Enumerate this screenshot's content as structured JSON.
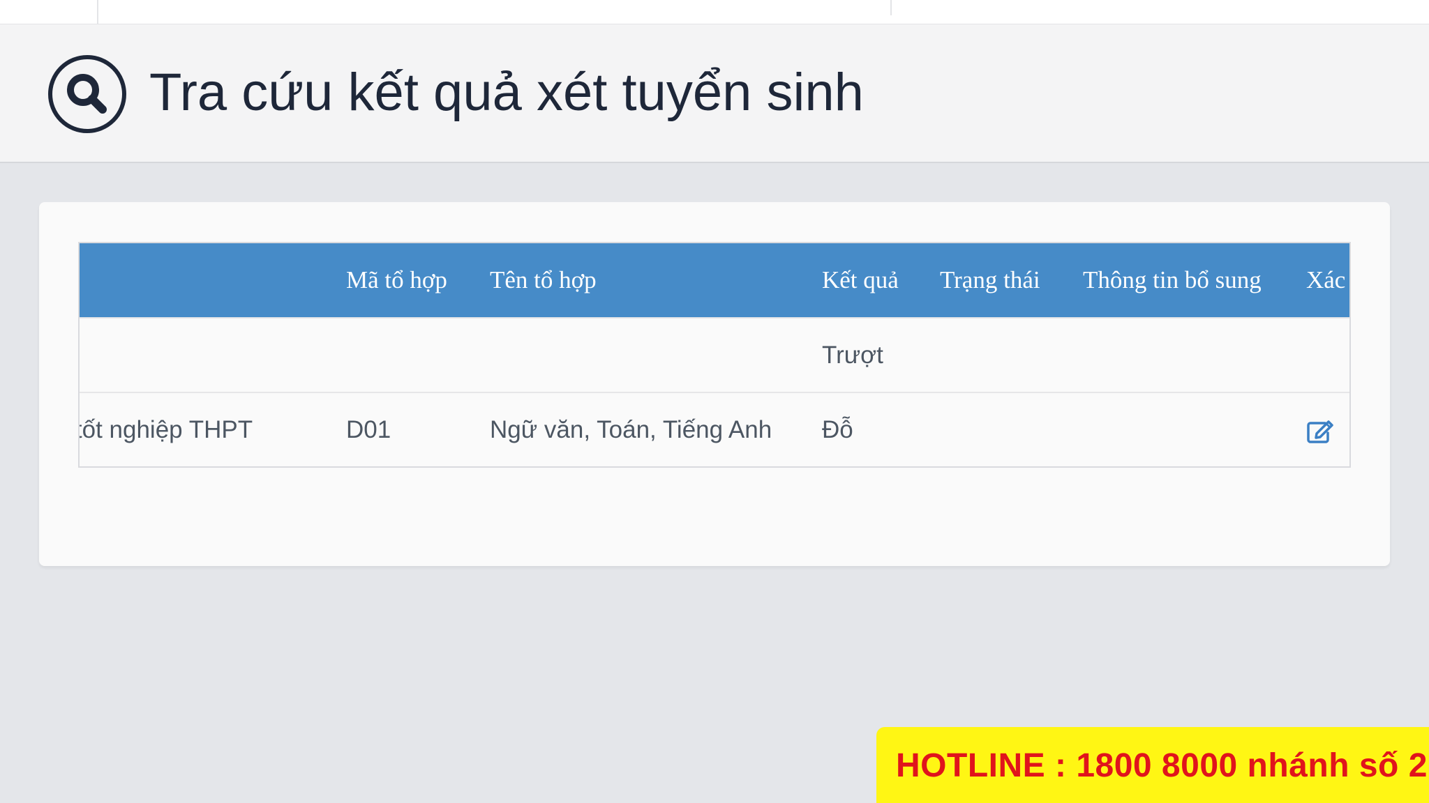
{
  "header": {
    "title": "Tra cứu kết quả xét tuyển sinh",
    "icon": "search-icon"
  },
  "table": {
    "columns": [
      "",
      "",
      "Mã tổ hợp",
      "Tên tổ hợp",
      "Kết quả",
      "Trạng thái",
      "Thông tin bổ sung",
      "Xác"
    ],
    "rows": [
      {
        "c0": "",
        "c1": "",
        "c2": "",
        "c3": "",
        "c4": "Trượt",
        "c5": "",
        "c6": "",
        "c7": ""
      },
      {
        "c0": "",
        "c1": "à thi tốt nghiệp THPT",
        "c2": "D01",
        "c3": "Ngữ văn, Toán, Tiếng Anh",
        "c4": "Đỗ",
        "c5": "",
        "c6": "",
        "c7": "edit-icon"
      }
    ]
  },
  "hotline": {
    "text": "HOTLINE : 1800 8000 nhánh số 2"
  },
  "colors": {
    "table_header": "#468bc8",
    "hotline_bg": "#fff614",
    "hotline_text": "#e0141c",
    "edit_icon": "#3b7fc4"
  }
}
